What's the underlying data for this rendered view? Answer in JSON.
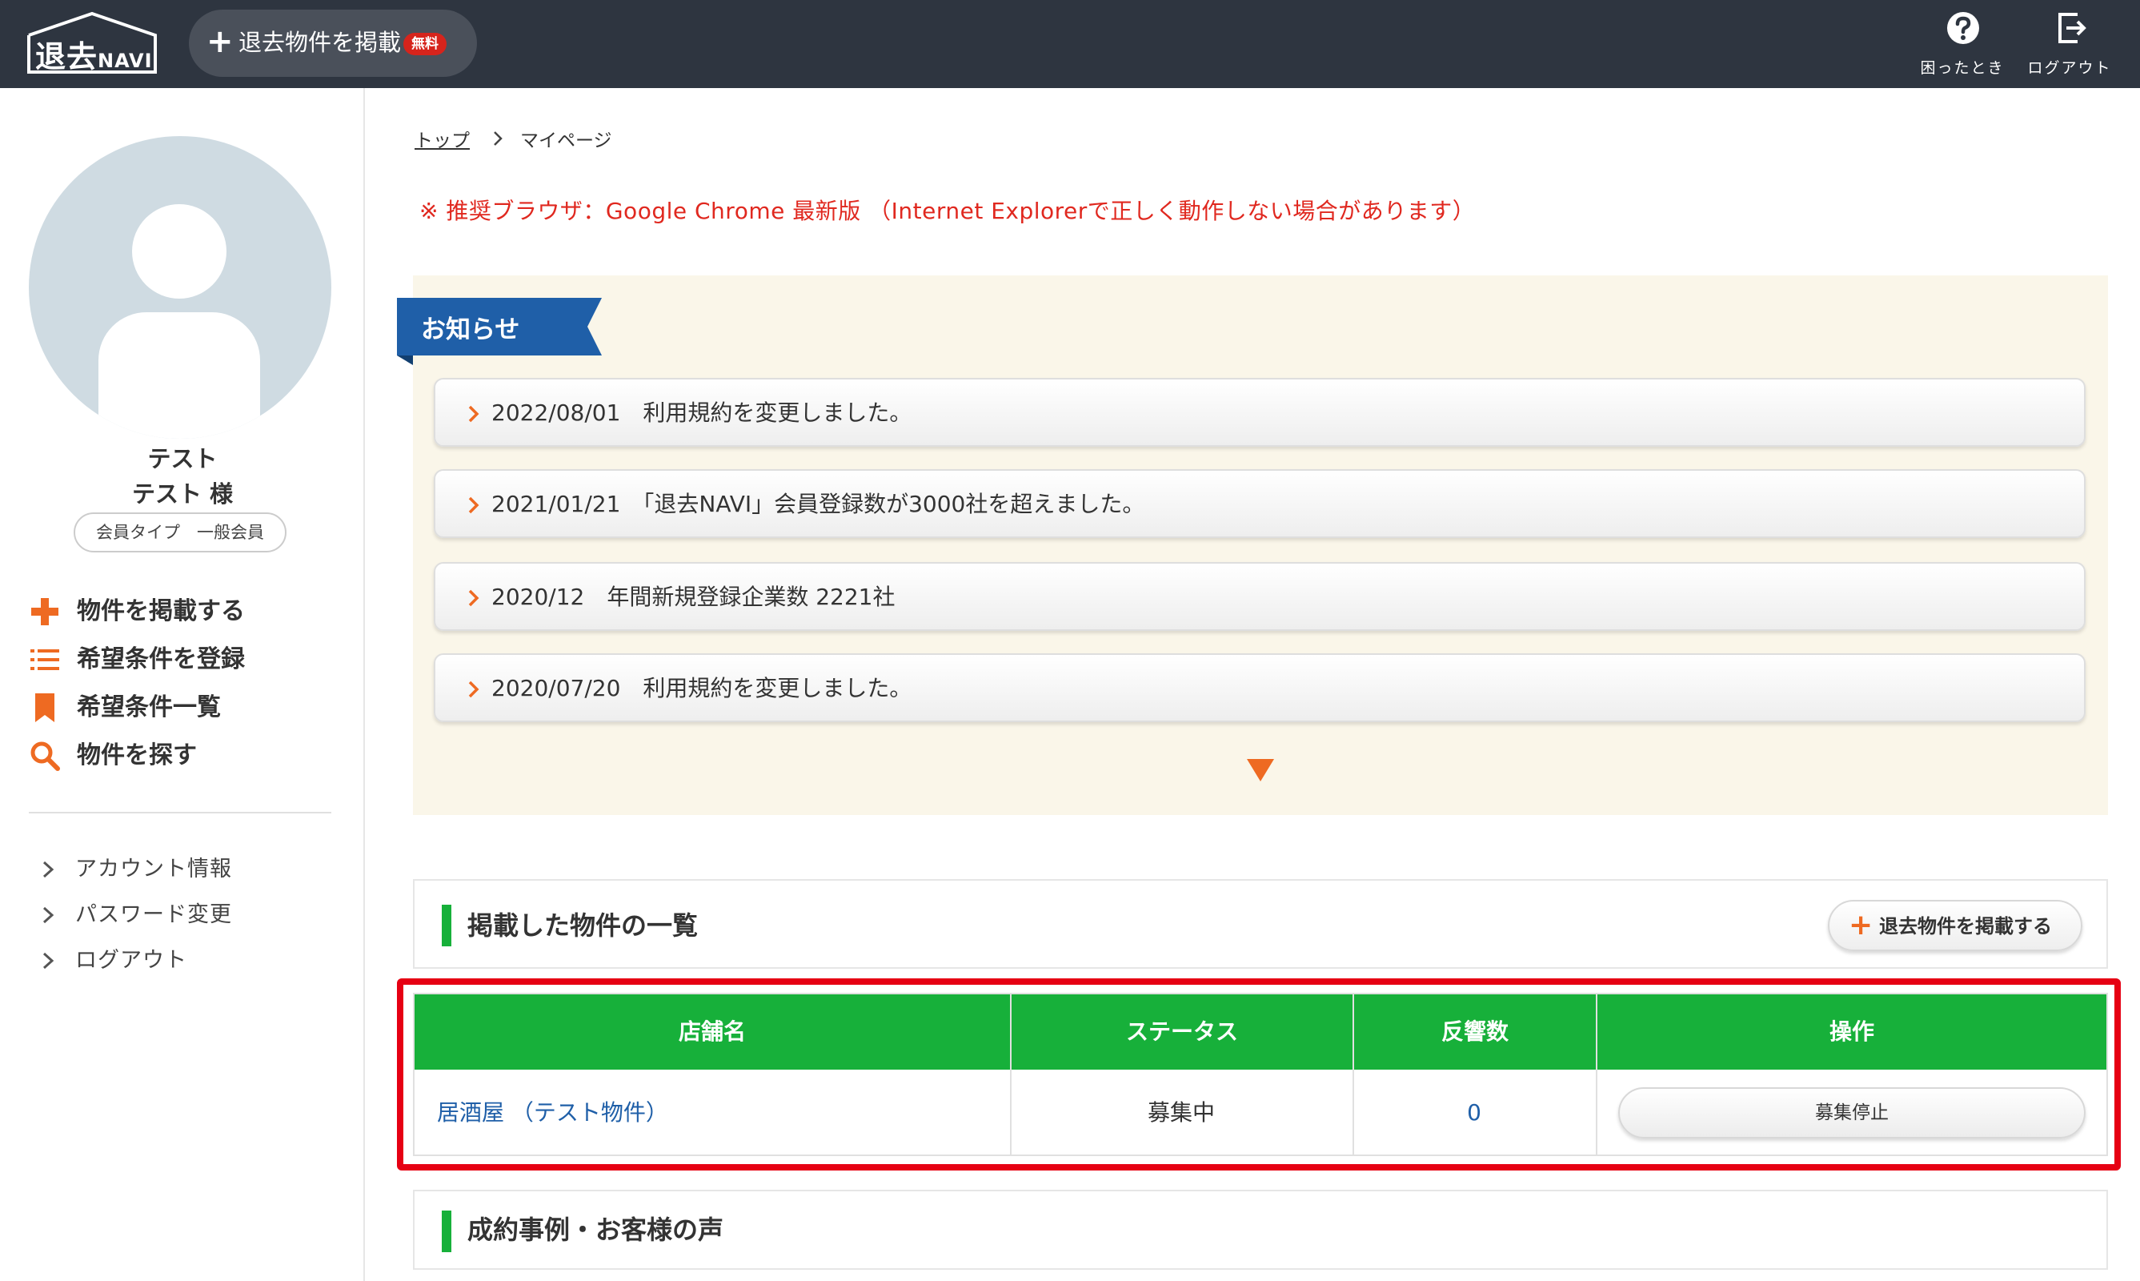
{
  "header": {
    "logo_text": "退去",
    "logo_sub": "NAVI",
    "post_button_label": "退去物件を掲載",
    "post_button_badge": "無料",
    "help_label": "困ったとき",
    "logout_label": "ログアウト"
  },
  "sidebar": {
    "user_company": "テスト",
    "user_name": "テスト 様",
    "member_type": "会員タイプ　一般会員",
    "menu": [
      {
        "label": "物件を掲載する",
        "icon": "plus-icon"
      },
      {
        "label": "希望条件を登録",
        "icon": "list-icon"
      },
      {
        "label": "希望条件一覧",
        "icon": "bookmark-icon"
      },
      {
        "label": "物件を探す",
        "icon": "search-icon"
      }
    ],
    "sub_menu": [
      {
        "label": "アカウント情報"
      },
      {
        "label": "パスワード変更"
      },
      {
        "label": "ログアウト"
      }
    ]
  },
  "breadcrumb": {
    "top": "トップ",
    "current": "マイページ"
  },
  "browser_notice": "※ 推奨ブラウザ：Google Chrome 最新版 （Internet Explorerで正しく動作しない場合があります）",
  "news": {
    "title": "お知らせ",
    "items": [
      {
        "text": "2022/08/01　利用規約を変更しました。"
      },
      {
        "text": "2021/01/21　「退去NAVI」会員登録数が3000社を超えました。"
      },
      {
        "text": "2020/12　年間新規登録企業数 2221社"
      },
      {
        "text": "2020/07/20　利用規約を変更しました。"
      }
    ]
  },
  "listings": {
    "title": "掲載した物件の一覧",
    "post_button_label": "退去物件を掲載する",
    "columns": [
      "店舗名",
      "ステータス",
      "反響数",
      "操作"
    ],
    "rows": [
      {
        "name": "居酒屋 （テスト物件）",
        "status": "募集中",
        "responses": "0",
        "action": "募集停止"
      }
    ]
  },
  "testimonials": {
    "title": "成約事例・お客様の声"
  },
  "colors": {
    "header_bg": "#2e3540",
    "accent_orange": "#ee6a22",
    "green": "#17b03a",
    "news_blue": "#1f5fa8",
    "notice_red": "#e0281f",
    "highlight_red": "#e60013",
    "link_blue": "#1f5fa8"
  }
}
